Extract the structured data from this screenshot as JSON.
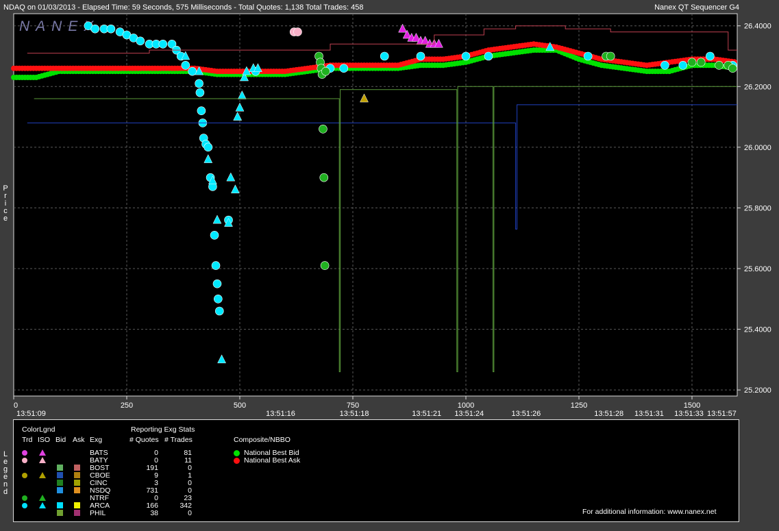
{
  "header": {
    "left": "NDAQ on 01/03/2013  -  Elapsed Time: 59 Seconds, 575 Milliseconds  -  Total Quotes: 1,138  Total Trades: 458",
    "right": "Nanex QT Sequencer G4"
  },
  "watermark": "NANEX",
  "side_labels": {
    "price": "Price",
    "legend": "Legend"
  },
  "chart_data": {
    "type": "scatter",
    "title": "",
    "xlabel": "",
    "ylabel": "Price",
    "xlim": [
      0,
      1600
    ],
    "ylim": [
      25.18,
      26.44
    ],
    "x_ticks": [
      0,
      250,
      500,
      750,
      1000,
      1250,
      1500
    ],
    "x_tick_labels": [
      "0",
      "250",
      "500",
      "750",
      "1000",
      "1250",
      "1500"
    ],
    "time_labels": [
      {
        "x": 0,
        "label": "13:51:09"
      },
      {
        "x": 585,
        "label": "13:51:16"
      },
      {
        "x": 748,
        "label": "13:51:18"
      },
      {
        "x": 908,
        "label": "13:51:21"
      },
      {
        "x": 1002,
        "label": "13:51:24"
      },
      {
        "x": 1128,
        "label": "13:51:26"
      },
      {
        "x": 1311,
        "label": "13:51:28"
      },
      {
        "x": 1400,
        "label": "13:51:31"
      },
      {
        "x": 1488,
        "label": "13:51:33"
      },
      {
        "x": 1570,
        "label": "13:51:57"
      }
    ],
    "y_ticks": [
      25.2,
      25.4,
      25.6,
      25.8,
      26.0,
      26.2,
      26.4
    ],
    "y_tick_labels": [
      "25.2000",
      "25.4000",
      "25.6000",
      "25.8000",
      "26.0000",
      "26.2000",
      "26.4000"
    ],
    "grid": true,
    "series": [
      {
        "name": "National Best Bid",
        "color": "#00e000",
        "x": [
          0,
          50,
          100,
          150,
          200,
          250,
          300,
          350,
          400,
          450,
          500,
          550,
          600,
          650,
          700,
          750,
          800,
          850,
          900,
          950,
          1000,
          1050,
          1100,
          1150,
          1200,
          1250,
          1300,
          1350,
          1400,
          1450,
          1500,
          1550,
          1600
        ],
        "y": [
          26.23,
          26.23,
          26.25,
          26.25,
          26.25,
          26.25,
          26.25,
          26.25,
          26.25,
          26.24,
          26.24,
          26.24,
          26.24,
          26.25,
          26.26,
          26.26,
          26.26,
          26.26,
          26.27,
          26.27,
          26.28,
          26.3,
          26.31,
          26.32,
          26.32,
          26.29,
          26.27,
          26.26,
          26.25,
          26.25,
          26.27,
          26.27,
          26.26
        ]
      },
      {
        "name": "National Best Ask",
        "color": "#ff1010",
        "x": [
          0,
          50,
          100,
          150,
          200,
          250,
          300,
          350,
          400,
          450,
          500,
          550,
          600,
          650,
          700,
          750,
          800,
          850,
          900,
          950,
          1000,
          1050,
          1100,
          1150,
          1200,
          1250,
          1300,
          1350,
          1400,
          1450,
          1500,
          1550,
          1600
        ],
        "y": [
          26.26,
          26.26,
          26.26,
          26.26,
          26.26,
          26.26,
          26.26,
          26.26,
          26.26,
          26.25,
          26.25,
          26.25,
          26.25,
          26.26,
          26.27,
          26.27,
          26.27,
          26.27,
          26.29,
          26.29,
          26.3,
          26.32,
          26.33,
          26.34,
          26.33,
          26.31,
          26.29,
          26.28,
          26.27,
          26.28,
          26.29,
          26.29,
          26.28
        ]
      },
      {
        "name": "ARCA trades",
        "color": "#00e8ff",
        "marker": "circle",
        "x": [
          165,
          180,
          200,
          215,
          235,
          250,
          265,
          280,
          300,
          315,
          330,
          350,
          360,
          370,
          380,
          395,
          410,
          412,
          415,
          418,
          420,
          425,
          430,
          435,
          440,
          444,
          447,
          450,
          452,
          455,
          475,
          535,
          700,
          730,
          820,
          900,
          1000,
          1050,
          1270,
          1440,
          1480,
          1540,
          1590
        ],
        "y": [
          26.4,
          26.39,
          26.39,
          26.39,
          26.38,
          26.37,
          26.36,
          26.35,
          26.34,
          26.34,
          26.34,
          26.34,
          26.32,
          26.3,
          26.27,
          26.25,
          26.21,
          26.18,
          26.12,
          26.08,
          26.03,
          26.01,
          26.0,
          25.9,
          25.87,
          25.71,
          25.61,
          25.55,
          25.5,
          25.46,
          25.76,
          26.25,
          26.26,
          26.26,
          26.3,
          26.3,
          26.3,
          26.3,
          26.3,
          26.27,
          26.27,
          26.3,
          26.27
        ],
        "triangle_x": [
          380,
          410,
          430,
          440,
          450,
          460,
          475,
          480,
          490,
          495,
          500,
          505,
          510,
          515,
          530,
          540,
          1186
        ],
        "triangle_y": [
          26.3,
          26.25,
          25.96,
          25.89,
          25.76,
          25.3,
          25.75,
          25.9,
          25.86,
          26.1,
          26.13,
          26.17,
          26.23,
          26.25,
          26.26,
          26.26,
          26.33
        ]
      },
      {
        "name": "BATS trades",
        "color": "#e020e0",
        "marker": "triangle",
        "x": [
          860,
          870,
          880,
          890,
          900,
          910,
          920,
          930,
          940
        ],
        "y": [
          26.39,
          26.37,
          26.36,
          26.36,
          26.35,
          26.35,
          26.34,
          26.34,
          26.34
        ]
      },
      {
        "name": "NTRF trades",
        "color": "#20b020",
        "marker": "circle",
        "x": [
          675,
          678,
          680,
          682,
          684,
          686,
          688,
          690,
          1310,
          1320,
          1500,
          1520,
          1560,
          1580,
          1590
        ],
        "y": [
          26.3,
          26.28,
          26.26,
          26.24,
          26.06,
          25.9,
          25.61,
          26.25,
          26.3,
          26.3,
          26.28,
          26.28,
          26.27,
          26.27,
          26.26
        ]
      },
      {
        "name": "CBOE trade",
        "color": "#c0a000",
        "marker": "triangle",
        "x": [
          775
        ],
        "y": [
          26.16
        ]
      },
      {
        "name": "BATY trades",
        "color": "#f8b0c8",
        "marker": "circle",
        "x": [
          620,
          628
        ],
        "y": [
          26.38,
          26.38
        ]
      },
      {
        "name": "NSDQ ask",
        "color": "#c04050",
        "x": [
          30,
          300,
          300,
          700,
          700,
          930,
          930,
          1040,
          1040,
          1110,
          1110,
          1220,
          1220,
          1320,
          1320,
          1580,
          1580,
          1600
        ],
        "y": [
          26.31,
          26.31,
          26.32,
          26.32,
          26.34,
          26.34,
          26.37,
          26.37,
          26.39,
          26.39,
          26.4,
          26.4,
          26.39,
          26.39,
          26.38,
          26.38,
          26.32,
          26.32
        ]
      },
      {
        "name": "NSDQ bid",
        "color": "#2040c0",
        "x": [
          30,
          1110,
          1110,
          1113,
          1113,
          1600
        ],
        "y": [
          26.08,
          26.08,
          25.73,
          25.73,
          26.14,
          26.14
        ]
      },
      {
        "name": "BOST bid",
        "color": "#5a9a3a",
        "x": [
          45,
          720,
          720,
          722,
          722,
          980,
          980,
          982,
          982,
          1060,
          1060,
          1062,
          1062,
          1600
        ],
        "y": [
          26.16,
          26.16,
          25.26,
          25.26,
          26.19,
          26.19,
          25.26,
          25.26,
          26.2,
          26.2,
          25.26,
          25.26,
          26.2,
          26.2
        ]
      }
    ],
    "legend": "bottom"
  },
  "legend": {
    "col_headers": {
      "color": "ColorLgnd",
      "trd": "Trd",
      "iso": "ISO",
      "bid": "Bid",
      "ask": "Ask",
      "exg": "Exg"
    },
    "stats_header": "Reporting Exg Stats",
    "quotes_header": "# Quotes",
    "trades_header": "# Trades",
    "composite_header": "Composite/NBBO",
    "nbb": "National Best Bid",
    "nba": "National Best Ask",
    "footer": "For additional information: www.nanex.net",
    "rows": [
      {
        "exg": "BATS",
        "quotes": "0",
        "trades": "81",
        "trd": "#e040e0",
        "iso": "#e040e0",
        "bid": "",
        "ask": ""
      },
      {
        "exg": "BATY",
        "quotes": "0",
        "trades": "11",
        "trd": "#f8b0c8",
        "iso": "#f8b0c8",
        "bid": "",
        "ask": ""
      },
      {
        "exg": "BOST",
        "quotes": "191",
        "trades": "0",
        "trd": "",
        "iso": "",
        "bid": "#60b060",
        "ask": "#c06060"
      },
      {
        "exg": "CBOE",
        "quotes": "9",
        "trades": "1",
        "trd": "#b0a000",
        "iso": "#b0a000",
        "bid": "#2050b0",
        "ask": "#b08010"
      },
      {
        "exg": "CINC",
        "quotes": "3",
        "trades": "0",
        "trd": "",
        "iso": "",
        "bid": "#208020",
        "ask": "#a0a000"
      },
      {
        "exg": "NSDQ",
        "quotes": "731",
        "trades": "0",
        "trd": "",
        "iso": "",
        "bid": "#2090e0",
        "ask": "#e09020"
      },
      {
        "exg": "NTRF",
        "quotes": "0",
        "trades": "23",
        "trd": "#20b020",
        "iso": "#20b020",
        "bid": "",
        "ask": ""
      },
      {
        "exg": "ARCA",
        "quotes": "166",
        "trades": "342",
        "trd": "#00e0ff",
        "iso": "#00e0ff",
        "bid": "#00e0ff",
        "ask": "#f0f000"
      },
      {
        "exg": "PHIL",
        "quotes": "38",
        "trades": "0",
        "trd": "",
        "iso": "",
        "bid": "#70a030",
        "ask": "#a03070"
      }
    ]
  }
}
